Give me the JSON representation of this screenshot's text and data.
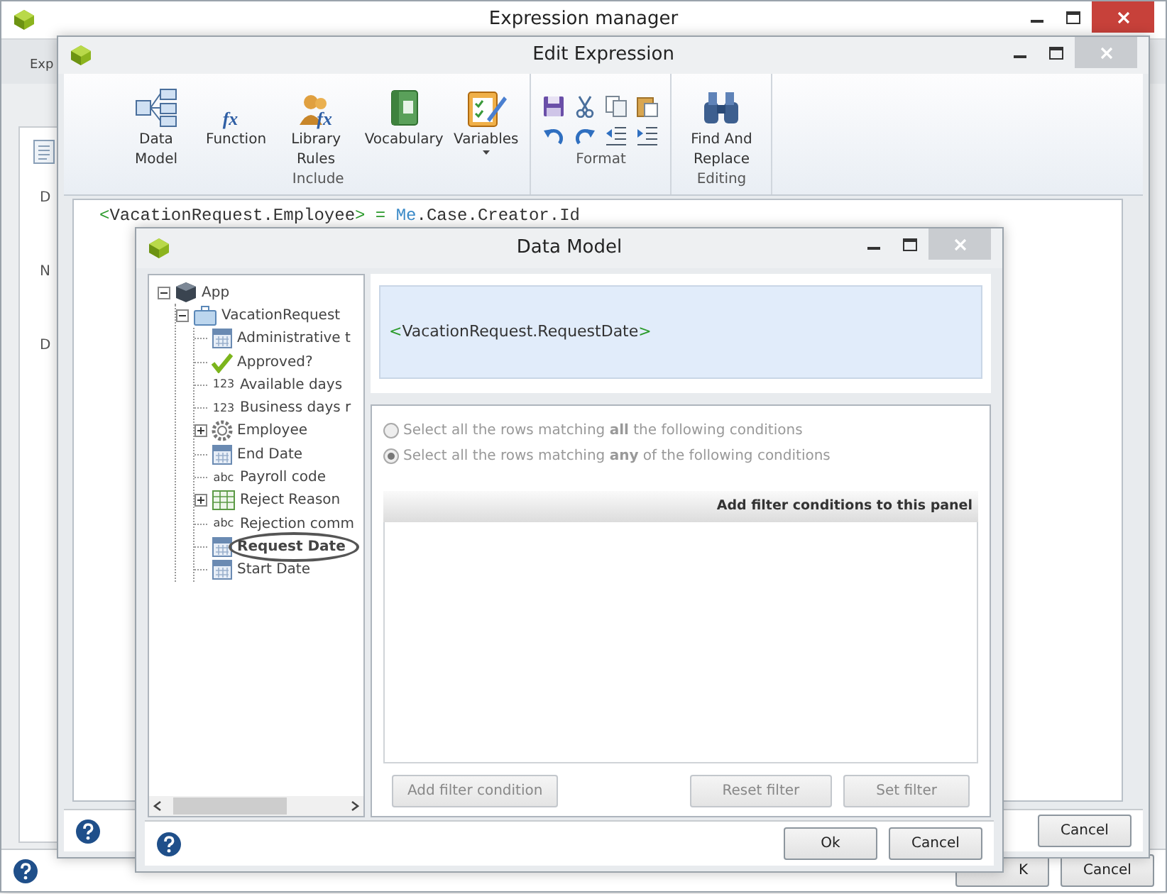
{
  "expression_manager": {
    "title": "Expression manager",
    "tab": "Exp",
    "labels": [
      "D",
      "N",
      "D"
    ],
    "buttons": [
      "K",
      "Cancel"
    ]
  },
  "edit_expression": {
    "title": "Edit Expression",
    "ribbon": [
      {
        "label": "Include",
        "kind": "large",
        "items": [
          {
            "label": "Data Model",
            "dropdown": false
          },
          {
            "label": "Function",
            "glyph": "fx",
            "dropdown": false
          },
          {
            "label": "Library Rules",
            "glyph": "fx",
            "dropdown": false
          },
          {
            "label": "Vocabulary",
            "dropdown": false
          },
          {
            "label": "Variables",
            "dropdown": true
          }
        ]
      },
      {
        "label": "Format",
        "kind": "small"
      },
      {
        "label": "Editing",
        "kind": "large",
        "items": [
          {
            "label": "Find And Replace",
            "dropdown": false
          }
        ]
      }
    ],
    "expression": [
      {
        "text": "<",
        "kind": "bracket"
      },
      {
        "text": "VacationRequest.Employee",
        "kind": "identifier"
      },
      {
        "text": ">",
        "kind": "bracket"
      },
      {
        "text": " = ",
        "kind": "operator"
      },
      {
        "text": "Me",
        "kind": "keyword"
      },
      {
        "text": ".Case.Creator.Id",
        "kind": "identifier"
      }
    ],
    "buttons": [
      "Cancel"
    ]
  },
  "data_model": {
    "title": "Data Model",
    "tree": [
      {
        "label": "App",
        "kind": "cube",
        "expanded": true,
        "selected": false,
        "children": [
          {
            "label": "VacationRequest",
            "kind": "briefcase",
            "expanded": true,
            "selected": false,
            "children": [
              {
                "label": "Administrative t",
                "kind": "date",
                "selected": false
              },
              {
                "label": "Approved?",
                "kind": "check",
                "selected": false
              },
              {
                "label": "Available days",
                "kind": "typed",
                "type_label": "123",
                "selected": false
              },
              {
                "label": "Business days r",
                "kind": "typed",
                "type_label": "123",
                "selected": false
              },
              {
                "label": "Employee",
                "kind": "gear",
                "expanded": false,
                "selected": false
              },
              {
                "label": "End Date",
                "kind": "date",
                "selected": false
              },
              {
                "label": "Payroll code",
                "kind": "typed",
                "type_label": "abc",
                "selected": false
              },
              {
                "label": "Reject Reason",
                "kind": "table",
                "expanded": false,
                "selected": false
              },
              {
                "label": "Rejection comm",
                "kind": "typed",
                "type_label": "abc",
                "selected": false
              },
              {
                "label": "Request Date",
                "kind": "date",
                "selected": true
              },
              {
                "label": "Start Date",
                "kind": "date",
                "selected": false
              }
            ]
          }
        ]
      }
    ],
    "preview": [
      {
        "text": "<",
        "kind": "bracket"
      },
      {
        "text": "VacationRequest.RequestDate",
        "kind": "identifier"
      },
      {
        "text": ">",
        "kind": "bracket"
      }
    ],
    "radios": [
      {
        "label": "Select all the rows matching **all** the following conditions",
        "selected": false
      },
      {
        "label": "Select all the rows matching **any** of the following conditions",
        "selected": true
      }
    ],
    "filter_header": "Add filter conditions to this panel",
    "filter_buttons": [
      {
        "label": "Add filter condition",
        "disabled": true
      },
      {
        "label": "Reset filter",
        "disabled": true
      },
      {
        "label": "Set filter",
        "disabled": true
      }
    ],
    "buttons": [
      "Ok",
      "Cancel"
    ]
  }
}
